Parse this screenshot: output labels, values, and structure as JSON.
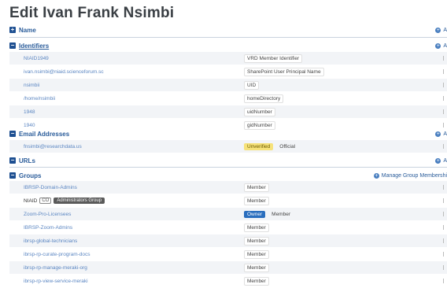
{
  "page": {
    "title": "Edit Ivan Frank Nsimbi"
  },
  "sections": {
    "name": {
      "title": "Name",
      "toggle": "+",
      "action": "A"
    },
    "identifiers": {
      "title": "Identifiers",
      "toggle": "−",
      "action": "A",
      "rows": [
        {
          "value": "NIAID1949",
          "type": "VRD Member Identifier"
        },
        {
          "value": "ivan.nsimbi@niaid.scienceforum.sc",
          "type": "SharePoint User Principal Name"
        },
        {
          "value": "nsimbii",
          "type": "UID"
        },
        {
          "value": "/home/nsimbii",
          "type": "homeDirectory"
        },
        {
          "value": "1948",
          "type": "uidNumber"
        },
        {
          "value": "1940",
          "type": "gidNumber"
        }
      ]
    },
    "email": {
      "title": "Email Addresses",
      "toggle": "−",
      "action": "A",
      "rows": [
        {
          "value": "fnsimbi@researchdata.us",
          "badge": "Unverified",
          "type": "Official"
        }
      ]
    },
    "urls": {
      "title": "URLs",
      "toggle": "−",
      "action": "A"
    },
    "groups": {
      "title": "Groups",
      "toggle": "−",
      "action": "Manage Group Membershi",
      "rows": [
        {
          "value": "IBRSP-Domain-Admins",
          "type": "Member"
        },
        {
          "value": "NIAID",
          "tag1": "CO",
          "tag2": "Administrators Group",
          "type": "Member"
        },
        {
          "value": "Zoom-Pro-Licensees",
          "badge": "Owner",
          "type": "Member"
        },
        {
          "value": "IBRSP-Zoom-Admins",
          "type": "Member"
        },
        {
          "value": "ibrsp-global-technicians",
          "type": "Member"
        },
        {
          "value": "ibrsp-rp-curate-program-docs",
          "type": "Member"
        },
        {
          "value": "ibrsp-rp-manage-meraki-org",
          "type": "Member"
        },
        {
          "value": "ibrsp-rp-view-service-meraki",
          "type": "Member"
        }
      ]
    }
  }
}
